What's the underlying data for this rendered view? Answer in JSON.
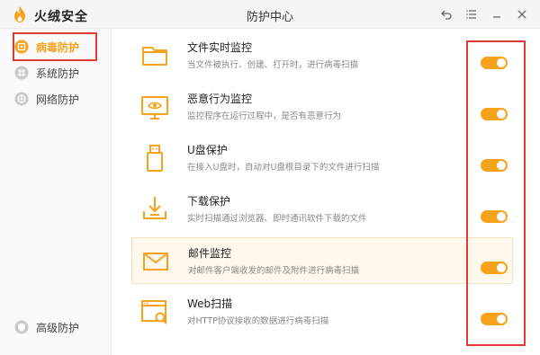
{
  "app": {
    "brand": "火绒安全",
    "window_title": "防护中心"
  },
  "window_controls": [
    "return-icon",
    "menu-icon",
    "minimize-icon",
    "close-icon"
  ],
  "sidebar": {
    "items": [
      {
        "label": "病毒防护",
        "icon": "virus-shield-icon",
        "active": true
      },
      {
        "label": "系统防护",
        "icon": "windows-icon",
        "active": false
      },
      {
        "label": "网络防护",
        "icon": "globe-icon",
        "active": false
      },
      {
        "label": "高级防护",
        "icon": "advanced-shield-icon",
        "active": false
      }
    ]
  },
  "protections": [
    {
      "title": "文件实时监控",
      "desc": "当文件被执行、创建、打开时，进行病毒扫描",
      "icon": "folder-icon",
      "enabled": true
    },
    {
      "title": "恶意行为监控",
      "desc": "监控程序在运行过程中，是否有恶意行为",
      "icon": "monitor-eye-icon",
      "enabled": true
    },
    {
      "title": "U盘保护",
      "desc": "在接入U盘时，自动对U盘根目录下的文件进行扫描",
      "icon": "usb-drive-icon",
      "enabled": true
    },
    {
      "title": "下载保护",
      "desc": "实时扫描通过浏览器、即时通讯软件下载的文件",
      "icon": "download-icon",
      "enabled": true
    },
    {
      "title": "邮件监控",
      "desc": "对邮件客户端收发的邮件及附件进行病毒扫描",
      "icon": "mail-icon",
      "enabled": true
    },
    {
      "title": "Web扫描",
      "desc": "对HTTP协议接收的数据进行病毒扫描",
      "icon": "web-scan-icon",
      "enabled": true
    }
  ],
  "colors": {
    "accent": "#f7a21b",
    "annotation": "#e53935",
    "row_highlight": "#fff8ec"
  }
}
